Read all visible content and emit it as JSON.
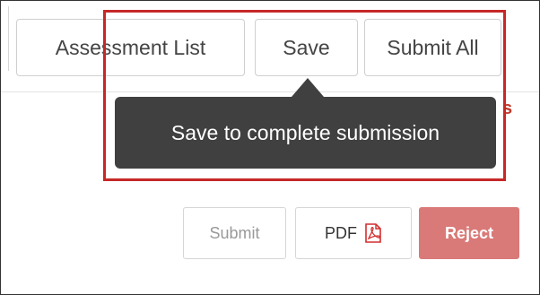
{
  "toolbar": {
    "buttons": [
      {
        "label": "Assessment List"
      },
      {
        "label": "Save"
      },
      {
        "label": "Submit All"
      }
    ]
  },
  "tooltip": {
    "text": "Save to complete submission"
  },
  "partially_visible_text": "s",
  "actions": {
    "submit_label": "Submit",
    "pdf_label": "PDF",
    "reject_label": "Reject",
    "pdf_icon": "pdf-file-icon"
  },
  "colors": {
    "highlight": "#c62828",
    "tooltip_bg": "#404040",
    "reject_bg": "#d97a78",
    "pdf_icon_red": "#d32f2f"
  }
}
